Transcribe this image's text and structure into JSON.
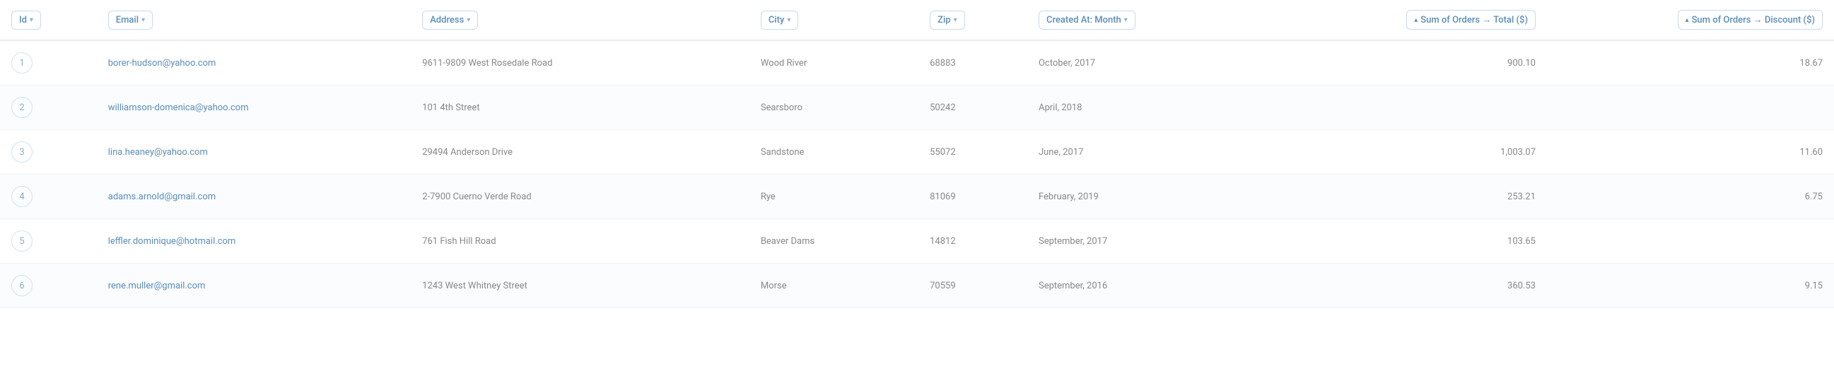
{
  "columns": {
    "id": {
      "label": "Id",
      "sort": true
    },
    "email": {
      "label": "Email",
      "sort": true
    },
    "address": {
      "label": "Address",
      "sort": true
    },
    "city": {
      "label": "City",
      "sort": true
    },
    "zip": {
      "label": "Zip",
      "sort": true
    },
    "created_at": {
      "label": "Created At: Month",
      "sort": true
    },
    "total": {
      "label": "Sum of Orders → Total ($)",
      "sort": true
    },
    "discount": {
      "label": "Sum of Orders → Discount ($)",
      "sort": true
    }
  },
  "rows": [
    {
      "id": 1,
      "email": "borer-hudson@yahoo.com",
      "address": "9611-9809 West Rosedale Road",
      "city": "Wood River",
      "zip": "68883",
      "created_at": "October, 2017",
      "total": "900.10",
      "discount": "18.67"
    },
    {
      "id": 2,
      "email": "williamson-domenica@yahoo.com",
      "address": "101 4th Street",
      "city": "Searsboro",
      "zip": "50242",
      "created_at": "April, 2018",
      "total": "",
      "discount": ""
    },
    {
      "id": 3,
      "email": "lina.heaney@yahoo.com",
      "address": "29494 Anderson Drive",
      "city": "Sandstone",
      "zip": "55072",
      "created_at": "June, 2017",
      "total": "1,003.07",
      "discount": "11.60"
    },
    {
      "id": 4,
      "email": "adams.arnold@gmail.com",
      "address": "2-7900 Cuerno Verde Road",
      "city": "Rye",
      "zip": "81069",
      "created_at": "February, 2019",
      "total": "253.21",
      "discount": "6.75"
    },
    {
      "id": 5,
      "email": "leffler.dominique@hotmail.com",
      "address": "761 Fish Hill Road",
      "city": "Beaver Dams",
      "zip": "14812",
      "created_at": "September, 2017",
      "total": "103.65",
      "discount": ""
    },
    {
      "id": 6,
      "email": "rene.muller@gmail.com",
      "address": "1243 West Whitney Street",
      "city": "Morse",
      "zip": "70559",
      "created_at": "September, 2016",
      "total": "360.53",
      "discount": "9.15"
    }
  ]
}
